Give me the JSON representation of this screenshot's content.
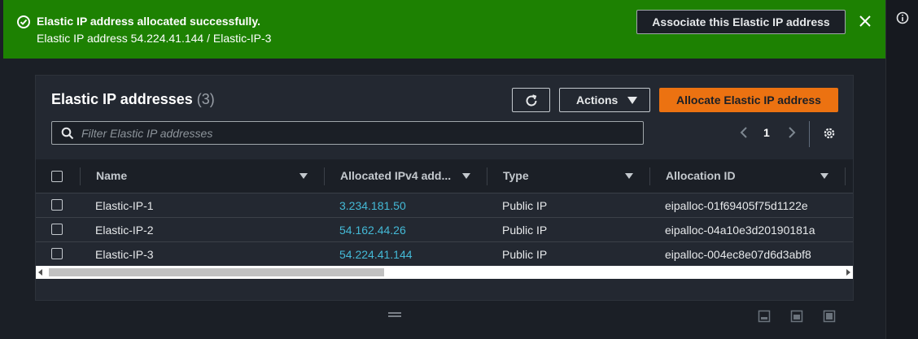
{
  "flash": {
    "title": "Elastic IP address allocated successfully.",
    "message": "Elastic IP address 54.224.41.144 / Elastic-IP-3",
    "action_label": "Associate this Elastic IP address",
    "color": "#1d8102"
  },
  "panel": {
    "title": "Elastic IP addresses",
    "count": "(3)",
    "actions_label": "Actions",
    "allocate_label": "Allocate Elastic IP address",
    "filter_placeholder": "Filter Elastic IP addresses",
    "page_number": "1"
  },
  "table": {
    "columns": [
      "Name",
      "Allocated IPv4 add...",
      "Type",
      "Allocation ID"
    ],
    "rows": [
      {
        "name": "Elastic-IP-1",
        "ip": "3.234.181.50",
        "type": "Public IP",
        "allocation_id": "eipalloc-01f69405f75d1122e"
      },
      {
        "name": "Elastic-IP-2",
        "ip": "54.162.44.26",
        "type": "Public IP",
        "allocation_id": "eipalloc-04a10e3d20190181a"
      },
      {
        "name": "Elastic-IP-3",
        "ip": "54.224.41.144",
        "type": "Public IP",
        "allocation_id": "eipalloc-004ec8e07d6d3abf8"
      }
    ]
  },
  "colors": {
    "accent": "#ec7211",
    "link": "#44b9d6",
    "success": "#1d8102"
  },
  "icons": [
    "success-check-icon",
    "close-icon",
    "info-icon",
    "refresh-icon",
    "search-icon",
    "chevron-left-icon",
    "chevron-right-icon",
    "settings-gear-icon",
    "drag-handle-icon",
    "view-mode-icon"
  ]
}
